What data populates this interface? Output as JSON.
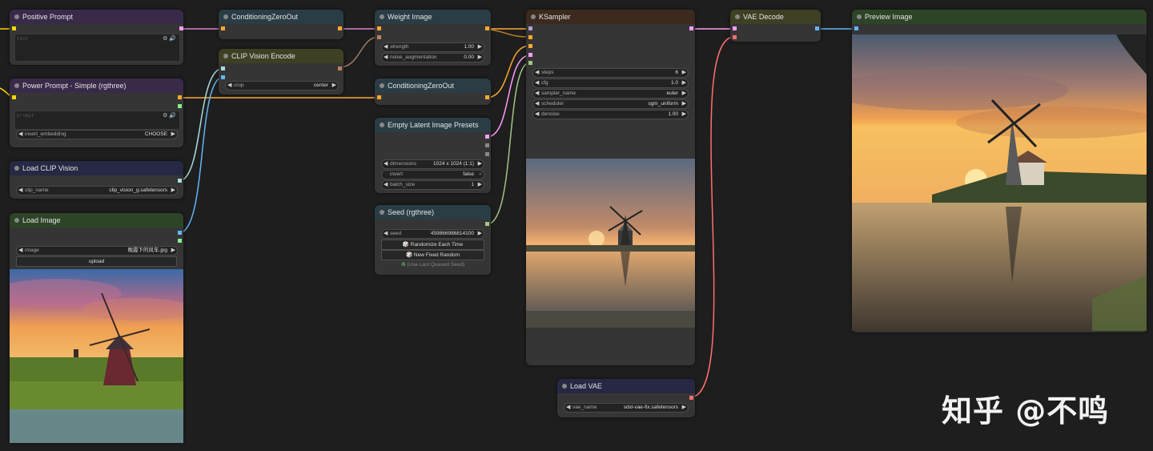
{
  "nodes": {
    "positive_prompt": {
      "title": "Positive Prompt",
      "placeholder": "text"
    },
    "power_prompt": {
      "title": "Power Prompt - Simple (rgthree)",
      "placeholder": "prompt",
      "insert_embedding": {
        "label": "insert_embedding",
        "value": "CHOOSE"
      }
    },
    "load_clip_vision": {
      "title": "Load CLIP Vision",
      "clip_name": {
        "label": "clip_name",
        "value": "clip_vision_g.safetensors"
      }
    },
    "load_image": {
      "title": "Load Image",
      "image": {
        "label": "image",
        "value": "晚霞下的风车.jpg"
      },
      "upload_label": "upload"
    },
    "cond_zero_1": {
      "title": "ConditioningZeroOut"
    },
    "clip_vision_encode": {
      "title": "CLIP Vision Encode",
      "crop": {
        "label": "crop",
        "value": "center"
      }
    },
    "weight_image": {
      "title": "Weight Image",
      "strength": {
        "label": "strength",
        "value": "1.00"
      },
      "noise_augmentation": {
        "label": "noise_augmentation",
        "value": "0.00"
      }
    },
    "cond_zero_2": {
      "title": "ConditioningZeroOut"
    },
    "empty_latent": {
      "title": "Empty Latent Image Presets",
      "dimensions": {
        "label": "dimensions",
        "value": "1024 x 1024 (1:1)"
      },
      "invert": {
        "label": "invert",
        "value": "false"
      },
      "batch_size": {
        "label": "batch_size",
        "value": "1"
      }
    },
    "seed": {
      "title": "Seed (rgthree)",
      "seed": {
        "label": "seed",
        "value": "459866986814100"
      },
      "randomize_label": "Randomize Each Time",
      "new_fixed_label": "New Fixed Random",
      "last_queued_label": "(Use Last Queued Seed)"
    },
    "ksampler": {
      "title": "KSampler",
      "steps": {
        "label": "steps",
        "value": "6"
      },
      "cfg": {
        "label": "cfg",
        "value": "1.0"
      },
      "sampler_name": {
        "label": "sampler_name",
        "value": "euler"
      },
      "scheduler": {
        "label": "scheduler",
        "value": "sgm_uniform"
      },
      "denoise": {
        "label": "denoise",
        "value": "1.00"
      }
    },
    "load_vae": {
      "title": "Load VAE",
      "vae_name": {
        "label": "vae_name",
        "value": "sdxl-vae-fix.safetensors"
      }
    },
    "vae_decode": {
      "title": "VAE Decode"
    },
    "preview_image": {
      "title": "Preview Image"
    }
  },
  "watermark": "知乎 @不鸣",
  "colors": {
    "conditioning": "#ffa931",
    "clip": "#ffd500",
    "clip_vision": "#a8dadc",
    "image": "#64b5f6",
    "latent": "#ff9cf9",
    "int": "#a3c585",
    "vae": "#ff6e6e",
    "node_bg": "#353535",
    "canvas_bg": "#1e1e1e"
  }
}
